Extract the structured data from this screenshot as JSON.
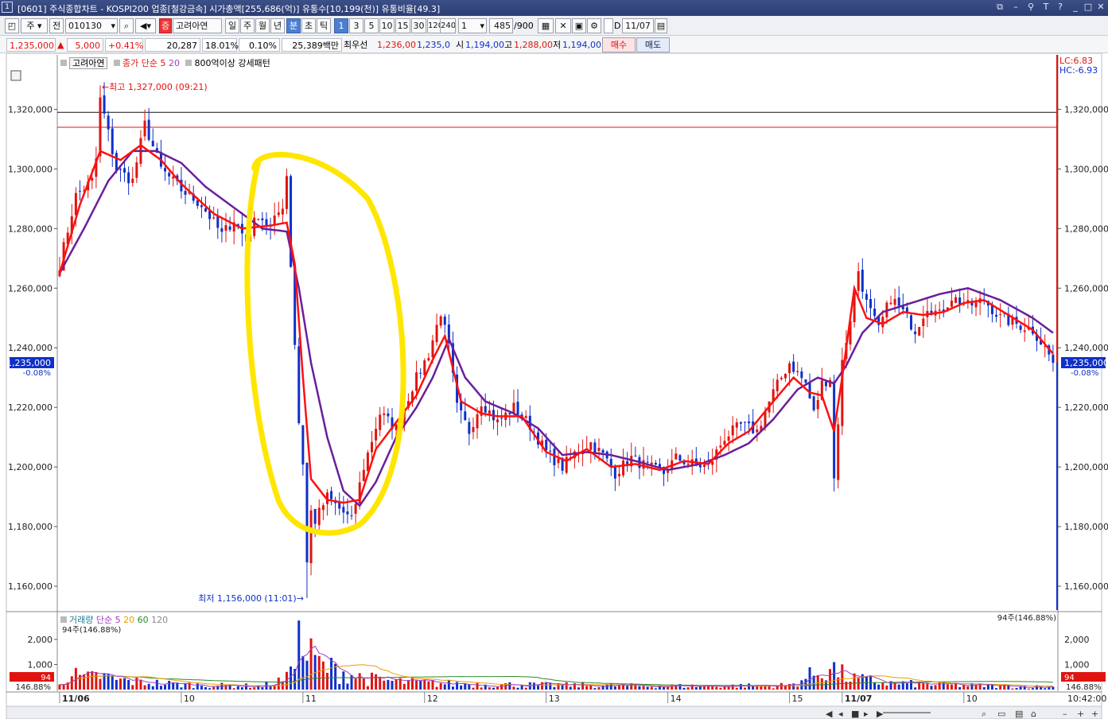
{
  "window": {
    "number": "1",
    "title": "[0601] 주식종합차트 - KOSPI200 업종[철강금속] 시가총액[255,686(억)] 유통수[10,199(천)] 유통비율[49.3]"
  },
  "toolbar": {
    "market_mode": "주",
    "prev_label": "전",
    "code": "010130",
    "stock_name": "고려아연",
    "stock_badge": "증",
    "periods": [
      "일",
      "주",
      "월",
      "년",
      "분",
      "초",
      "틱"
    ],
    "selected_period": "분",
    "intervals": [
      "1",
      "3",
      "5",
      "10",
      "15",
      "30",
      "120",
      "240"
    ],
    "selected_interval": "1",
    "unit_value": "1",
    "count_value": "485",
    "count_max": "/900",
    "date_checkbox_label": "D",
    "date_value": "11/07"
  },
  "price_bar": {
    "price": "1,235,000",
    "arrow": "▲",
    "change": "5,000",
    "change_pct": "+0.41%",
    "volume": "20,287",
    "turnover_pct": "18.01%",
    "ratio_pct": "0.10%",
    "amount": "25,389백만",
    "best_bid_label": "최우선",
    "best_ask": "1,236,00",
    "best_bid": "1,235,0",
    "open_label": "시",
    "open": "1,194,00",
    "high_label": "고",
    "high": "1,288,00",
    "low_label": "저",
    "low": "1,194,00",
    "buy_label": "매수",
    "sell_label": "매도"
  },
  "price_legend": {
    "name": "고려아연",
    "ma_label": "종가 단순",
    "ma_fast": "5",
    "ma_slow": "20",
    "pattern": "800억이상 강세패턴"
  },
  "volume_legend": {
    "label": "거래량",
    "ma_label": "단순",
    "periods": [
      "5",
      "20",
      "60",
      "120"
    ]
  },
  "right_info": {
    "lc": "LC:6.83",
    "hc": "HC:-6.93"
  },
  "colors": {
    "up": "#e0140f",
    "down": "#1030c8",
    "ma5": "#ff1010",
    "ma20": "#6a1f9a",
    "highlight": "#ffe600",
    "vol_ma5": "#a040c0",
    "vol_ma20": "#e8a000",
    "vol_ma60": "#2a8a2a"
  },
  "chart_data": [
    {
      "type": "candlestick",
      "title": "",
      "y_ticks": [
        "1,160,000",
        "1,180,000",
        "1,200,000",
        "1,220,000",
        "1,240,000",
        "1,260,000",
        "1,280,000",
        "1,300,000",
        "1,320,000"
      ],
      "ylim": [
        1152000,
        1334000
      ],
      "x_labels": [
        "11/06",
        "10",
        "11",
        "12",
        "13",
        "14",
        "15",
        "11/07",
        "10"
      ],
      "x_label_index": [
        0,
        30,
        60,
        90,
        120,
        150,
        180,
        193,
        223
      ],
      "n_bars": 246,
      "current_price": 1235000,
      "current_label": "1,235,000",
      "current_change": "-0.08%",
      "high_annotation": "최고 1,327,000 (09:21)",
      "high_value": 1327000,
      "high_index": 10,
      "low_annotation": "최저 1,156,000 (11:01)",
      "low_value": 1156000,
      "low_index": 61,
      "reference_lines": [
        1319000,
        1314000
      ],
      "close_anchors": [
        [
          0,
          1268000
        ],
        [
          4,
          1291000
        ],
        [
          8,
          1296000
        ],
        [
          11,
          1318000
        ],
        [
          14,
          1300000
        ],
        [
          18,
          1296000
        ],
        [
          21,
          1315000
        ],
        [
          25,
          1300000
        ],
        [
          30,
          1293000
        ],
        [
          35,
          1288000
        ],
        [
          40,
          1278000
        ],
        [
          43,
          1283000
        ],
        [
          46,
          1276000
        ],
        [
          49,
          1285000
        ],
        [
          52,
          1280000
        ],
        [
          55,
          1288000
        ],
        [
          56,
          1298000
        ],
        [
          57,
          1268000
        ],
        [
          59,
          1215000
        ],
        [
          61,
          1188000
        ],
        [
          63,
          1182000
        ],
        [
          66,
          1190000
        ],
        [
          69,
          1186000
        ],
        [
          72,
          1182000
        ],
        [
          75,
          1200000
        ],
        [
          79,
          1218000
        ],
        [
          83,
          1213000
        ],
        [
          87,
          1227000
        ],
        [
          91,
          1238000
        ],
        [
          94,
          1252000
        ],
        [
          96,
          1240000
        ],
        [
          98,
          1220000
        ],
        [
          101,
          1212000
        ],
        [
          104,
          1222000
        ],
        [
          108,
          1215000
        ],
        [
          112,
          1220000
        ],
        [
          116,
          1214000
        ],
        [
          120,
          1205000
        ],
        [
          124,
          1200000
        ],
        [
          128,
          1206000
        ],
        [
          131,
          1208000
        ],
        [
          134,
          1204000
        ],
        [
          137,
          1198000
        ],
        [
          141,
          1203000
        ],
        [
          145,
          1200000
        ],
        [
          149,
          1198000
        ],
        [
          152,
          1203000
        ],
        [
          156,
          1201000
        ],
        [
          160,
          1200000
        ],
        [
          164,
          1210000
        ],
        [
          168,
          1214000
        ],
        [
          172,
          1212000
        ],
        [
          176,
          1225000
        ],
        [
          180,
          1235000
        ],
        [
          184,
          1228000
        ],
        [
          186,
          1218000
        ],
        [
          188,
          1228000
        ],
        [
          190,
          1230000
        ],
        [
          191,
          1196000
        ],
        [
          193,
          1235000
        ],
        [
          195,
          1250000
        ],
        [
          197,
          1266000
        ],
        [
          199,
          1255000
        ],
        [
          202,
          1246000
        ],
        [
          205,
          1257000
        ],
        [
          208,
          1252000
        ],
        [
          211,
          1246000
        ],
        [
          214,
          1254000
        ],
        [
          217,
          1251000
        ],
        [
          220,
          1257000
        ],
        [
          224,
          1254000
        ],
        [
          228,
          1256000
        ],
        [
          232,
          1250000
        ],
        [
          236,
          1248000
        ],
        [
          240,
          1246000
        ],
        [
          243,
          1240000
        ],
        [
          245,
          1235000
        ]
      ],
      "ma5_anchors": [
        [
          0,
          1265000
        ],
        [
          5,
          1288000
        ],
        [
          10,
          1306000
        ],
        [
          15,
          1303000
        ],
        [
          20,
          1308000
        ],
        [
          25,
          1303000
        ],
        [
          30,
          1295000
        ],
        [
          38,
          1285000
        ],
        [
          45,
          1280000
        ],
        [
          52,
          1281000
        ],
        [
          56,
          1282000
        ],
        [
          58,
          1268000
        ],
        [
          60,
          1230000
        ],
        [
          62,
          1196000
        ],
        [
          66,
          1189000
        ],
        [
          70,
          1188000
        ],
        [
          74,
          1189000
        ],
        [
          78,
          1206000
        ],
        [
          83,
          1215000
        ],
        [
          88,
          1224000
        ],
        [
          92,
          1236000
        ],
        [
          95,
          1244000
        ],
        [
          99,
          1222000
        ],
        [
          104,
          1218000
        ],
        [
          108,
          1217000
        ],
        [
          114,
          1217000
        ],
        [
          120,
          1205000
        ],
        [
          125,
          1202000
        ],
        [
          130,
          1206000
        ],
        [
          136,
          1200000
        ],
        [
          142,
          1201000
        ],
        [
          148,
          1199000
        ],
        [
          154,
          1202000
        ],
        [
          160,
          1201000
        ],
        [
          165,
          1208000
        ],
        [
          170,
          1212000
        ],
        [
          176,
          1222000
        ],
        [
          181,
          1230000
        ],
        [
          185,
          1225000
        ],
        [
          188,
          1224000
        ],
        [
          191,
          1212000
        ],
        [
          193,
          1230000
        ],
        [
          196,
          1260000
        ],
        [
          199,
          1250000
        ],
        [
          203,
          1248000
        ],
        [
          208,
          1252000
        ],
        [
          213,
          1251000
        ],
        [
          218,
          1252000
        ],
        [
          223,
          1255000
        ],
        [
          228,
          1256000
        ],
        [
          234,
          1251000
        ],
        [
          240,
          1246000
        ],
        [
          245,
          1238000
        ]
      ],
      "ma20_anchors": [
        [
          0,
          1265000
        ],
        [
          6,
          1280000
        ],
        [
          12,
          1296000
        ],
        [
          18,
          1306000
        ],
        [
          24,
          1306000
        ],
        [
          30,
          1302000
        ],
        [
          36,
          1294000
        ],
        [
          44,
          1286000
        ],
        [
          50,
          1280000
        ],
        [
          56,
          1279000
        ],
        [
          59,
          1260000
        ],
        [
          62,
          1235000
        ],
        [
          66,
          1210000
        ],
        [
          70,
          1192000
        ],
        [
          74,
          1187000
        ],
        [
          78,
          1195000
        ],
        [
          83,
          1210000
        ],
        [
          88,
          1220000
        ],
        [
          92,
          1230000
        ],
        [
          96,
          1243000
        ],
        [
          100,
          1230000
        ],
        [
          105,
          1222000
        ],
        [
          112,
          1218000
        ],
        [
          118,
          1213000
        ],
        [
          124,
          1204000
        ],
        [
          130,
          1205000
        ],
        [
          136,
          1204000
        ],
        [
          142,
          1202000
        ],
        [
          150,
          1199000
        ],
        [
          158,
          1201000
        ],
        [
          164,
          1204000
        ],
        [
          170,
          1208000
        ],
        [
          176,
          1216000
        ],
        [
          182,
          1226000
        ],
        [
          187,
          1230000
        ],
        [
          191,
          1228000
        ],
        [
          194,
          1234000
        ],
        [
          198,
          1245000
        ],
        [
          203,
          1252000
        ],
        [
          210,
          1255000
        ],
        [
          217,
          1258000
        ],
        [
          224,
          1260000
        ],
        [
          232,
          1256000
        ],
        [
          240,
          1250000
        ],
        [
          245,
          1245000
        ]
      ],
      "highlight": "yellow hand-drawn ellipse around the 11:00 drop and rebound",
      "legend_position": "top-left"
    },
    {
      "type": "bar",
      "title": "거래량",
      "y_ticks": [
        "1,000",
        "2,000"
      ],
      "ylim": [
        0,
        2600
      ],
      "current_volume": "94",
      "current_volume_pct": "146.88%",
      "latest_annotation": "94주(146.88%)",
      "volume_anchors": [
        [
          0,
          300
        ],
        [
          2,
          650
        ],
        [
          6,
          420
        ],
        [
          10,
          560
        ],
        [
          14,
          380
        ],
        [
          20,
          300
        ],
        [
          30,
          200
        ],
        [
          40,
          160
        ],
        [
          50,
          140
        ],
        [
          56,
          420
        ],
        [
          58,
          2300
        ],
        [
          60,
          1500
        ],
        [
          62,
          1300
        ],
        [
          65,
          900
        ],
        [
          70,
          700
        ],
        [
          75,
          450
        ],
        [
          80,
          350
        ],
        [
          90,
          260
        ],
        [
          100,
          220
        ],
        [
          120,
          180
        ],
        [
          140,
          150
        ],
        [
          160,
          140
        ],
        [
          180,
          170
        ],
        [
          190,
          900
        ],
        [
          193,
          600
        ],
        [
          196,
          420
        ],
        [
          205,
          250
        ],
        [
          220,
          180
        ],
        [
          240,
          120
        ],
        [
          245,
          94
        ]
      ],
      "time_label": "10:42:00"
    }
  ]
}
